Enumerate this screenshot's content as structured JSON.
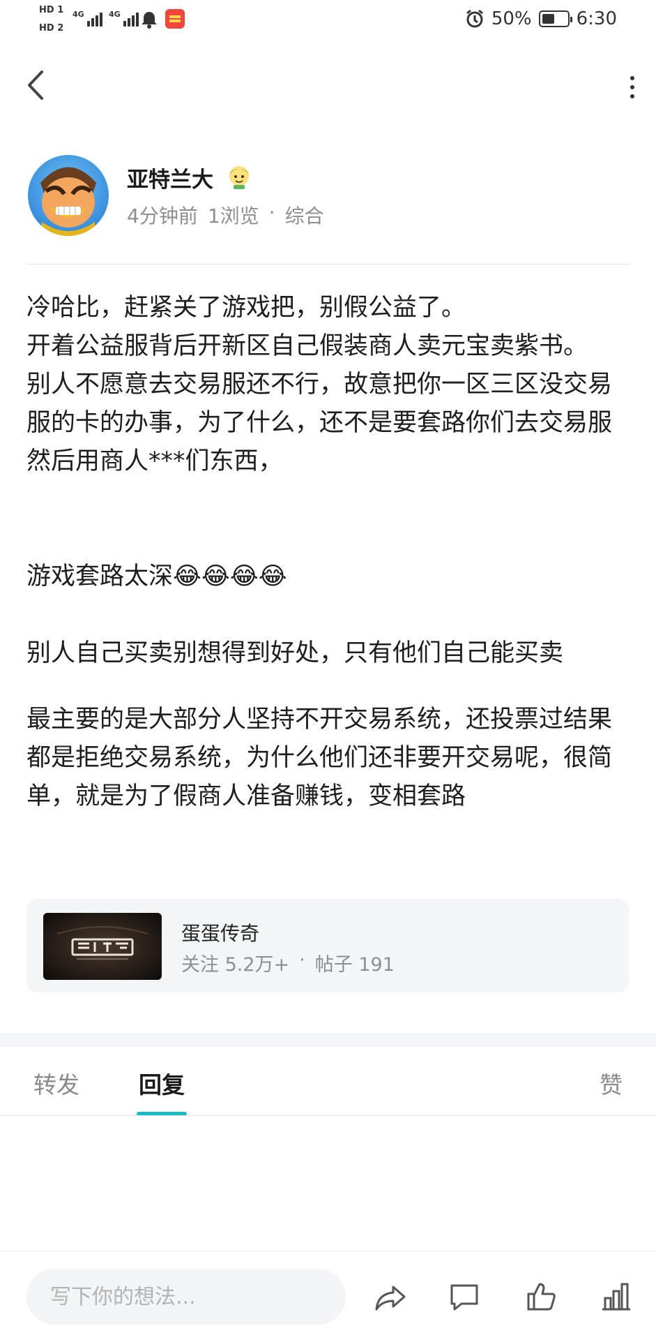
{
  "status_bar": {
    "hd1": "HD 1",
    "hd2": "HD 2",
    "net1": "4G",
    "net2": "4G",
    "battery_percent": "50%",
    "battery_level": 0.5,
    "time": "6:30"
  },
  "header": {
    "back_icon": "chevron-left-icon",
    "more_icon": "vertical-dots-icon"
  },
  "post": {
    "author": {
      "name": "亚特兰大",
      "meta_time": "4分钟前",
      "meta_views": "1浏览",
      "meta_sep": "·",
      "meta_category": "综合"
    },
    "paragraphs": [
      "冷哈比，赶紧关了游戏把，别假公益了。\n开着公益服背后开新区自己假装商人卖元宝卖紫书。\n别人不愿意去交易服还不行，故意把你一区三区没交易服的卡的办事，为了什么，还不是要套路你们去交易服然后用商人***们东西，",
      "游戏套路太深😂😂😂😂",
      "别人自己买卖别想得到好处，只有他们自己能买卖",
      "最主要的是大部分人坚持不开交易系统，还投票过结果都是拒绝交易系统，为什么他们还非要开交易呢，很简单，就是为了假商人准备赚钱，变相套路"
    ]
  },
  "game_card": {
    "name": "蛋蛋传奇",
    "follow": "关注 5.2万+",
    "sep": "·",
    "posts": "帖子 191"
  },
  "tabs": {
    "repost": "转发",
    "reply": "回复",
    "like": "赞"
  },
  "bottom_bar": {
    "input_placeholder": "写下你的想法...",
    "icons": [
      "share-icon",
      "comment-icon",
      "thumbs-up-icon",
      "chart-icon"
    ]
  },
  "colors": {
    "accent": "#19b9c6",
    "text_primary": "#1e1e1e",
    "text_secondary": "#8e8e8e",
    "card_bg": "#f4f5f7"
  }
}
